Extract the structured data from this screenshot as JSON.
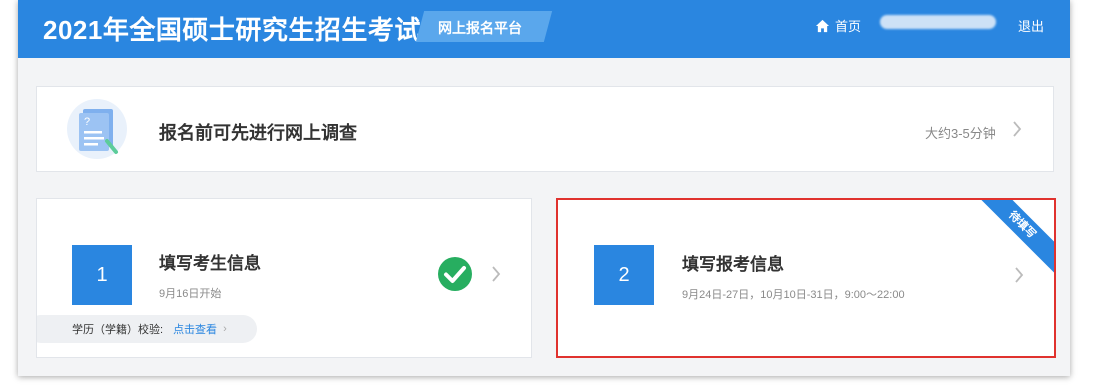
{
  "header": {
    "title": "2021年全国硕士研究生招生考试",
    "platform": "网上报名平台",
    "home_label": "首页",
    "logout_label": "退出"
  },
  "survey": {
    "title": "报名前可先进行网上调查",
    "time": "大约3-5分钟",
    "icon": "document-question-icon"
  },
  "steps": [
    {
      "number": "1",
      "title": "填写考生信息",
      "subtitle": "9月16日开始",
      "status": "completed",
      "verify_label": "学历（学籍）校验:",
      "verify_link": "点击查看"
    },
    {
      "number": "2",
      "title": "填写报考信息",
      "subtitle": "9月24日-27日，10月10日-31日，9:00～22:00",
      "badge": "待填写"
    }
  ],
  "colors": {
    "primary": "#2a86e0",
    "success": "#27ae60",
    "highlight_border": "#e0322e"
  }
}
